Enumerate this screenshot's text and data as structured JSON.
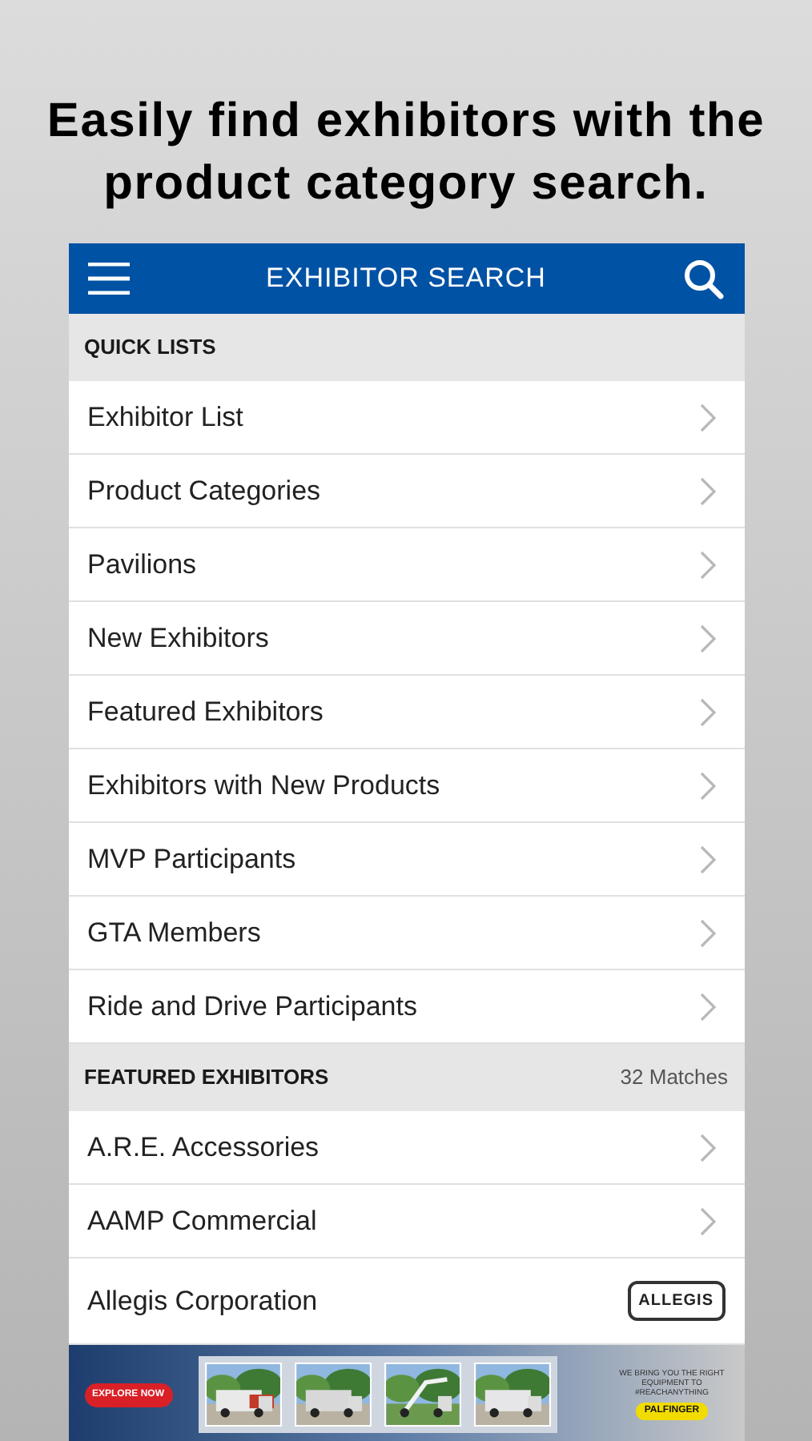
{
  "caption": "Easily find exhibitors with the product category search.",
  "header": {
    "title": "EXHIBITOR SEARCH"
  },
  "sections": [
    {
      "title": "QUICK LISTS",
      "items": [
        {
          "label": "Exhibitor List",
          "kind": "chevron"
        },
        {
          "label": "Product Categories",
          "kind": "chevron"
        },
        {
          "label": "Pavilions",
          "kind": "chevron"
        },
        {
          "label": "New Exhibitors",
          "kind": "chevron"
        },
        {
          "label": "Featured Exhibitors",
          "kind": "chevron"
        },
        {
          "label": "Exhibitors with New Products",
          "kind": "chevron"
        },
        {
          "label": "MVP Participants",
          "kind": "chevron"
        },
        {
          "label": "GTA Members",
          "kind": "chevron"
        },
        {
          "label": "Ride and Drive Participants",
          "kind": "chevron"
        }
      ]
    },
    {
      "title": "FEATURED EXHIBITORS",
      "count": "32 Matches",
      "items": [
        {
          "label": "A.R.E. Accessories",
          "kind": "chevron"
        },
        {
          "label": "AAMP Commercial",
          "kind": "chevron"
        },
        {
          "label": "Allegis Corporation",
          "kind": "logo",
          "logo": "ALLEGIS"
        }
      ]
    }
  ],
  "banner": {
    "button": "EXPLORE NOW",
    "tagline": "WE BRING YOU THE RIGHT EQUIPMENT TO #REACHANYTHING",
    "brand": "PALFINGER"
  }
}
